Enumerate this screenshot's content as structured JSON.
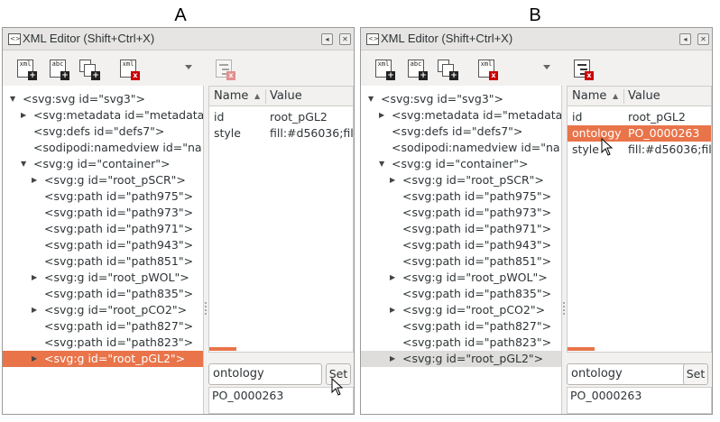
{
  "labels": {
    "a": "A",
    "b": "B"
  },
  "panel": {
    "title": "XML Editor (Shift+Ctrl+X)",
    "title_buttons": [
      "◂",
      "✕"
    ]
  },
  "toolbar": {
    "new_element_icon_text": "xml",
    "new_text_node_icon_text": "abc",
    "indent_icon_text": "<>",
    "delete_icon_text": "xml",
    "plus": "+",
    "delete_mark": "x"
  },
  "tree": {
    "rows": [
      {
        "label": "<svg:svg id=\"svg3\">",
        "arrow": "▼",
        "depth": 0
      },
      {
        "label": "<svg:metadata id=\"metadata",
        "arrow": "▶",
        "depth": 1
      },
      {
        "label": "<svg:defs id=\"defs7\">",
        "arrow": "",
        "depth": 1
      },
      {
        "label": "<sodipodi:namedview id=\"na",
        "arrow": "",
        "depth": 1
      },
      {
        "label": "<svg:g id=\"container\">",
        "arrow": "▼",
        "depth": 1
      },
      {
        "label": "<svg:g id=\"root_pSCR\">",
        "arrow": "▶",
        "depth": 2
      },
      {
        "label": "<svg:path id=\"path975\">",
        "arrow": "",
        "depth": 2
      },
      {
        "label": "<svg:path id=\"path973\">",
        "arrow": "",
        "depth": 2
      },
      {
        "label": "<svg:path id=\"path971\">",
        "arrow": "",
        "depth": 2
      },
      {
        "label": "<svg:path id=\"path943\">",
        "arrow": "",
        "depth": 2
      },
      {
        "label": "<svg:path id=\"path851\">",
        "arrow": "",
        "depth": 2
      },
      {
        "label": "<svg:g id=\"root_pWOL\">",
        "arrow": "▶",
        "depth": 2
      },
      {
        "label": "<svg:path id=\"path835\">",
        "arrow": "",
        "depth": 2
      },
      {
        "label": "<svg:g id=\"root_pCO2\">",
        "arrow": "▶",
        "depth": 2
      },
      {
        "label": "<svg:path id=\"path827\">",
        "arrow": "",
        "depth": 2
      },
      {
        "label": "<svg:path id=\"path823\">",
        "arrow": "",
        "depth": 2
      },
      {
        "label": "<svg:g id=\"root_pGL2\">",
        "arrow": "▶",
        "depth": 2,
        "selected": true
      }
    ]
  },
  "attributes": {
    "col_name": "Name",
    "col_value": "Value",
    "sort_arrow": "▲",
    "rows_a": [
      {
        "name": "id",
        "value": "root_pGL2"
      },
      {
        "name": "style",
        "value": "fill:#d56036;fil"
      }
    ],
    "rows_b": [
      {
        "name": "id",
        "value": "root_pGL2"
      },
      {
        "name": "ontology",
        "value": "PO_0000263",
        "selected": true
      },
      {
        "name": "style",
        "value": "fill:#d56036;fil"
      }
    ]
  },
  "editor": {
    "attr_name": "ontology",
    "set_label": "Set",
    "attr_value": "PO_0000263"
  },
  "colors": {
    "selection_orange": "#e9744a",
    "selection_grey": "#dedddb"
  }
}
